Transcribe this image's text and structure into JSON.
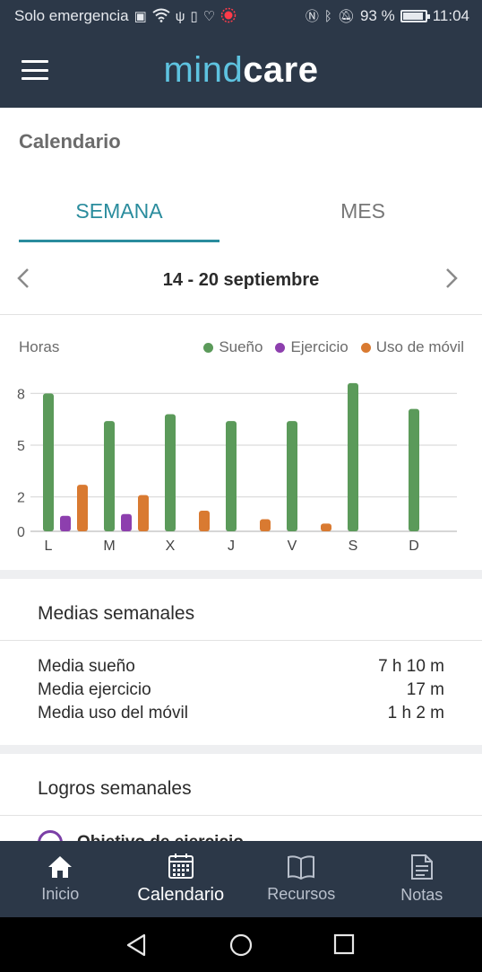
{
  "status_bar": {
    "carrier": "Solo emergencia",
    "battery_percent": "93 %",
    "battery_level": 0.93,
    "time": "11:04"
  },
  "app": {
    "logo_part1": "mind",
    "logo_part2": "care",
    "colors": {
      "primary_dark": "#2c3848",
      "accent": "#2a8c9d",
      "logo_light": "#5ec3e0"
    }
  },
  "page": {
    "title": "Calendario"
  },
  "tabs": [
    {
      "label": "SEMANA",
      "active": true
    },
    {
      "label": "MES",
      "active": false
    }
  ],
  "week_nav": {
    "range": "14 - 20 septiembre",
    "prev_icon": "chevron-left-icon",
    "next_icon": "chevron-right-icon"
  },
  "chart_data": {
    "type": "bar",
    "ylabel": "Horas",
    "categories": [
      "L",
      "M",
      "X",
      "J",
      "V",
      "S",
      "D"
    ],
    "y_ticks": [
      0,
      2,
      5,
      8
    ],
    "ylim": [
      0,
      8.6
    ],
    "grid": true,
    "legend_position": "top-right",
    "series": [
      {
        "name": "Sueño",
        "color": "#5b9a5a",
        "values": [
          8.0,
          6.4,
          6.8,
          6.4,
          6.4,
          8.6,
          7.1
        ]
      },
      {
        "name": "Ejercicio",
        "color": "#8d3fae",
        "values": [
          0.9,
          1.0,
          0,
          0,
          0,
          0,
          0
        ]
      },
      {
        "name": "Uso de móvil",
        "color": "#d97a31",
        "values": [
          2.7,
          2.1,
          1.2,
          0.7,
          0.45,
          0,
          0
        ]
      }
    ]
  },
  "weekly_averages": {
    "title": "Medias semanales",
    "rows": [
      {
        "label": "Media sueño",
        "value": "7 h 10 m"
      },
      {
        "label": "Media ejercicio",
        "value": "17 m"
      },
      {
        "label": "Media uso del móvil",
        "value": "1 h 2 m"
      }
    ]
  },
  "achievements": {
    "title": "Logros semanales",
    "first_item": "Objetivo de ejercicio"
  },
  "bottom_nav": [
    {
      "label": "Inicio",
      "icon": "home-icon",
      "active": false
    },
    {
      "label": "Calendario",
      "icon": "calendar-icon",
      "active": true
    },
    {
      "label": "Recursos",
      "icon": "book-icon",
      "active": false
    },
    {
      "label": "Notas",
      "icon": "notes-icon",
      "active": false
    }
  ]
}
